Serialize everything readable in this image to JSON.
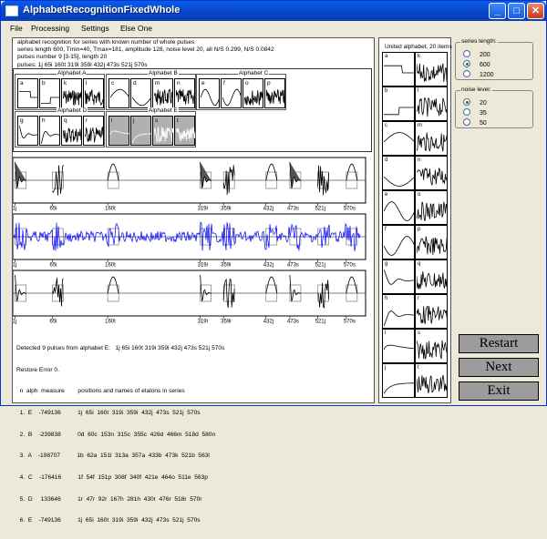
{
  "window": {
    "title": "AlphabetRecognitionFixedWhole"
  },
  "menu": [
    "File",
    "Processing",
    "Settings",
    "Else One"
  ],
  "info": {
    "lines": [
      "alphabet recognition for series with known number of whole pulses",
      "series length 600,  Tmin=40,  Tmax=181,   amplitude 128, noise level 20, all N/S 0.299,  N/S 0.0842",
      "pulses number 9 [3-15], length 20",
      "pulses:  1j 65i 160t 319i 359i 432j 473s 521j 570s"
    ]
  },
  "alphabet_groups": [
    {
      "name": "Alphabet A",
      "letters": [
        "a",
        "b",
        "k",
        "l"
      ]
    },
    {
      "name": "Alphabet B",
      "letters": [
        "c",
        "d",
        "m",
        "n"
      ]
    },
    {
      "name": "Alphabet C",
      "letters": [
        "e",
        "f",
        "o",
        "p"
      ]
    },
    {
      "name": "Alphabet D",
      "letters": [
        "g",
        "h",
        "q",
        "r"
      ]
    },
    {
      "name": "Alphabet E",
      "letters": [
        "i",
        "j",
        "s",
        "t"
      ]
    }
  ],
  "series_ticks": [
    "1j",
    "65i",
    "160t",
    "319i",
    "359i",
    "432j",
    "473s",
    "521j",
    "570s"
  ],
  "results": {
    "detected": "Detected 9 pulses from alphabet E:   1j 65i 160t 319i 359i 432j 473s 521j 570s",
    "restore_error": "Restore Error 0.",
    "header": "  n  alph  measure        positions and names of etalons in series",
    "rows": [
      "  1.  E    -749136          1j  65i  160t  319i  359i  432j  473s  521j  570s",
      "  2.  B    -239838          0d  60c  153n  315c  355c  426d  466m  518d  580n",
      "  3.  A    -198707          1b  62a  151l  313a  357a  433b  473k  521b  563l",
      "  4.  C    -176416          1f  54f  151p  308f  340f  421e  464o  511e  563p",
      "  5.  D     133646          1r  47r  92r  167h  281h  430r  476r  518r  570r",
      "  6.  E    -749136          1j  65i  160t  319i  359i  432j  473s  521j  570s"
    ]
  },
  "united_alphabet": {
    "title": "United alphabet, 20 items",
    "letters": [
      "a",
      "b",
      "c",
      "d",
      "e",
      "f",
      "g",
      "h",
      "i",
      "j",
      "k",
      "l",
      "m",
      "n",
      "o",
      "p",
      "q",
      "r",
      "s",
      "t"
    ]
  },
  "series_length": {
    "label": "series length:",
    "options": [
      "200",
      "600",
      "1200"
    ],
    "selected": "600"
  },
  "noise_level": {
    "label": "noise level:",
    "options": [
      "20",
      "35",
      "50"
    ],
    "selected": "20"
  },
  "buttons": {
    "restart": "Restart",
    "next": "Next",
    "exit": "Exit"
  },
  "colors": {
    "title_bar": "#0546C8",
    "noisy_series": "#0000FF",
    "recognized_gray": "#B0B0B0"
  }
}
